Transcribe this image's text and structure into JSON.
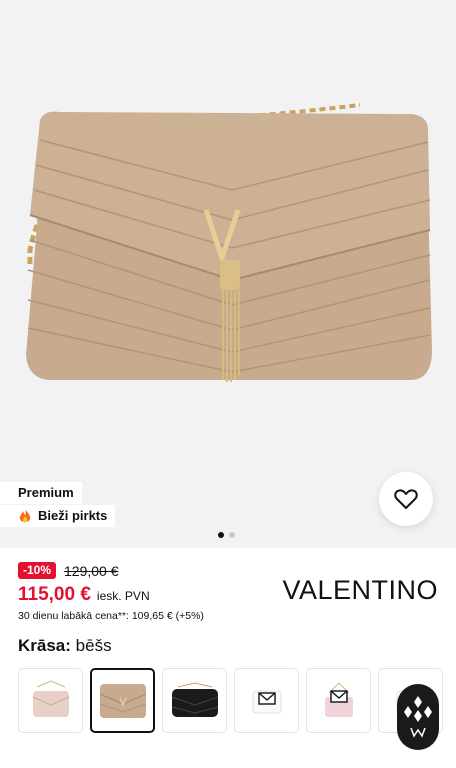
{
  "product": {
    "image_alt": "Valentino quilted beige shoulder bag with gold chain",
    "badges": {
      "premium": "Premium",
      "frequent": "Bieži pirkts"
    },
    "gallery": {
      "current": 1,
      "total": 2
    },
    "discount": "-10%",
    "old_price": "129,00 €",
    "price": "115,00 €",
    "vat_note": "iesk. PVN",
    "lowest_price_note": "30 dienu labākā cena**: 109,65 € (+5%)",
    "brand": "VALENTINO",
    "color_label_prefix": "Krāsa:",
    "color_value": "bēšs",
    "swatches": [
      {
        "name": "rozā",
        "color": "#e8cfc8"
      },
      {
        "name": "bēšs",
        "color": "#c8ab8e",
        "selected": true
      },
      {
        "name": "melns",
        "color": "#1b1b1b"
      },
      {
        "name": "balts",
        "color": "#ffffff"
      },
      {
        "name": "rozā gaišs",
        "color": "#f3d3da"
      },
      {
        "name": "balts 2",
        "color": "#ffffff"
      }
    ]
  },
  "colors": {
    "sale_red": "#e4102f",
    "bag_beige": "#c8ab8e",
    "hero_bg": "#f2f2f4"
  }
}
